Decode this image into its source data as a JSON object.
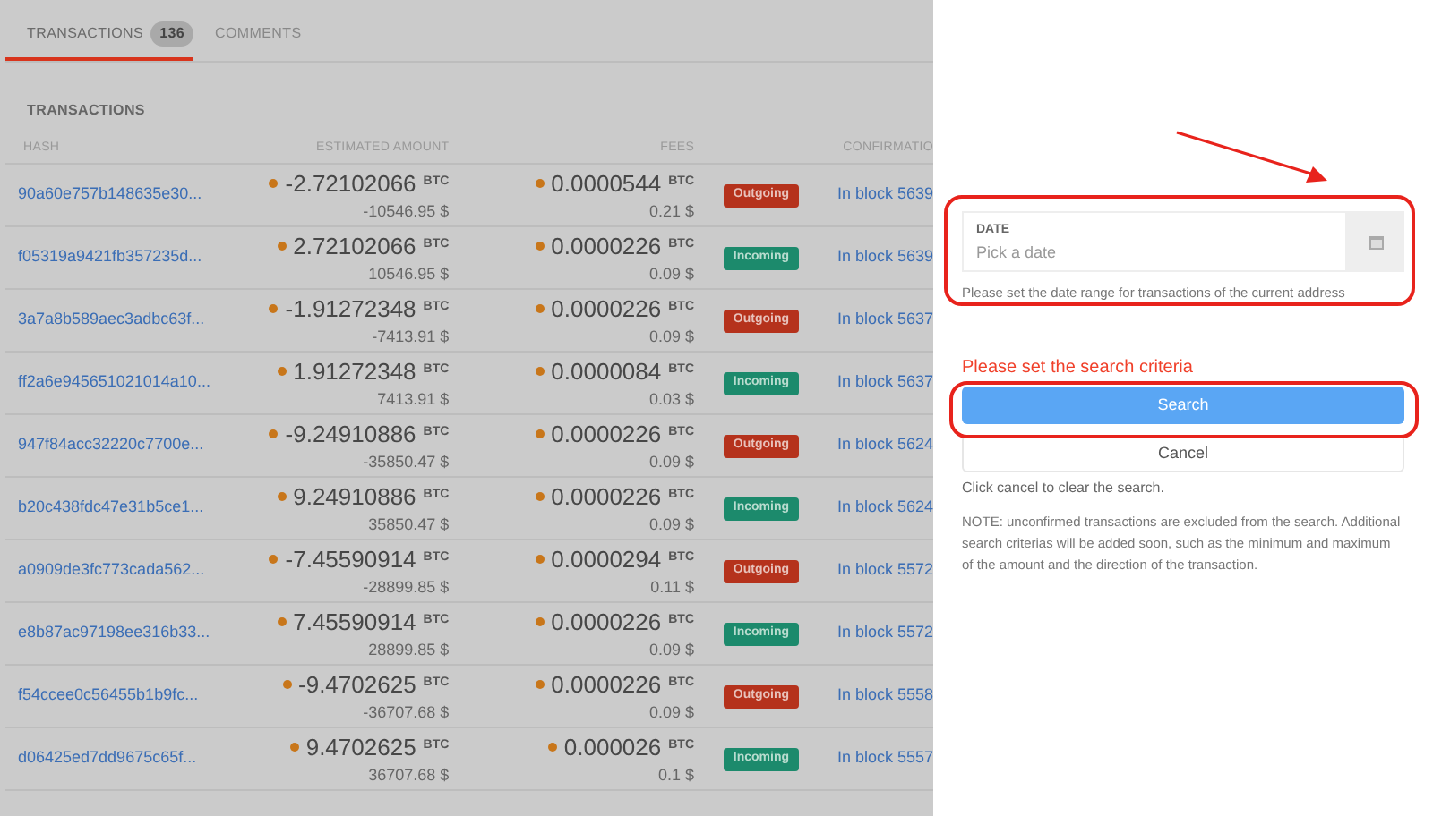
{
  "tabs": [
    {
      "label": "TRANSACTIONS",
      "count": "136",
      "selected": true
    },
    {
      "label": "COMMENTS",
      "selected": false
    }
  ],
  "section_title": "TRANSACTIONS",
  "table": {
    "columns": [
      "HASH",
      "ESTIMATED AMOUNT",
      "FEES",
      "CONFIRMATIO"
    ],
    "rows": [
      {
        "hash": "90a60e757b148635e30...",
        "amount": "-2.72102066",
        "amount_unit": "BTC",
        "amount_usd": "-10546.95 $",
        "fee": "0.0000544",
        "fee_unit": "BTC",
        "fee_usd": "0.21 $",
        "direction": "Outgoing",
        "kind": "outgoing",
        "confirmation": "In block 5639"
      },
      {
        "hash": "f05319a9421fb357235d...",
        "amount": "2.72102066",
        "amount_unit": "BTC",
        "amount_usd": "10546.95 $",
        "fee": "0.0000226",
        "fee_unit": "BTC",
        "fee_usd": "0.09 $",
        "direction": "Incoming",
        "kind": "incoming",
        "confirmation": "In block 5639"
      },
      {
        "hash": "3a7a8b589aec3adbc63f...",
        "amount": "-1.91272348",
        "amount_unit": "BTC",
        "amount_usd": "-7413.91 $",
        "fee": "0.0000226",
        "fee_unit": "BTC",
        "fee_usd": "0.09 $",
        "direction": "Outgoing",
        "kind": "outgoing",
        "confirmation": "In block 5637"
      },
      {
        "hash": "ff2a6e945651021014a10...",
        "amount": "1.91272348",
        "amount_unit": "BTC",
        "amount_usd": "7413.91 $",
        "fee": "0.0000084",
        "fee_unit": "BTC",
        "fee_usd": "0.03 $",
        "direction": "Incoming",
        "kind": "incoming",
        "confirmation": "In block 5637"
      },
      {
        "hash": "947f84acc32220c7700e...",
        "amount": "-9.24910886",
        "amount_unit": "BTC",
        "amount_usd": "-35850.47 $",
        "fee": "0.0000226",
        "fee_unit": "BTC",
        "fee_usd": "0.09 $",
        "direction": "Outgoing",
        "kind": "outgoing",
        "confirmation": "In block 5624"
      },
      {
        "hash": "b20c438fdc47e31b5ce1...",
        "amount": "9.24910886",
        "amount_unit": "BTC",
        "amount_usd": "35850.47 $",
        "fee": "0.0000226",
        "fee_unit": "BTC",
        "fee_usd": "0.09 $",
        "direction": "Incoming",
        "kind": "incoming",
        "confirmation": "In block 5624"
      },
      {
        "hash": "a0909de3fc773cada562...",
        "amount": "-7.45590914",
        "amount_unit": "BTC",
        "amount_usd": "-28899.85 $",
        "fee": "0.0000294",
        "fee_unit": "BTC",
        "fee_usd": "0.11 $",
        "direction": "Outgoing",
        "kind": "outgoing",
        "confirmation": "In block 5572"
      },
      {
        "hash": "e8b87ac97198ee316b33...",
        "amount": "7.45590914",
        "amount_unit": "BTC",
        "amount_usd": "28899.85 $",
        "fee": "0.0000226",
        "fee_unit": "BTC",
        "fee_usd": "0.09 $",
        "direction": "Incoming",
        "kind": "incoming",
        "confirmation": "In block 5572"
      },
      {
        "hash": "f54ccee0c56455b1b9fc...",
        "amount": "-9.4702625",
        "amount_unit": "BTC",
        "amount_usd": "-36707.68 $",
        "fee": "0.0000226",
        "fee_unit": "BTC",
        "fee_usd": "0.09 $",
        "direction": "Outgoing",
        "kind": "outgoing",
        "confirmation": "In block 5558"
      },
      {
        "hash": "d06425ed7dd9675c65f...",
        "amount": "9.4702625",
        "amount_unit": "BTC",
        "amount_usd": "36707.68 $",
        "fee": "0.000026",
        "fee_unit": "BTC",
        "fee_usd": "0.1 $",
        "direction": "Incoming",
        "kind": "incoming",
        "confirmation": "In block 5557"
      }
    ]
  },
  "drawer": {
    "date_label": "DATE",
    "date_placeholder": "Pick a date",
    "date_hint": "Please set the date range for transactions of the current address",
    "error": "Please set the search criteria",
    "search_button": "Search",
    "cancel_button": "Cancel",
    "cancel_hint": "Click cancel to clear the search.",
    "note": "NOTE: unconfirmed transactions are excluded from the search. Additional search criterias will be added soon, such as the minimum and maximum of the amount and the direction of the transaction."
  }
}
